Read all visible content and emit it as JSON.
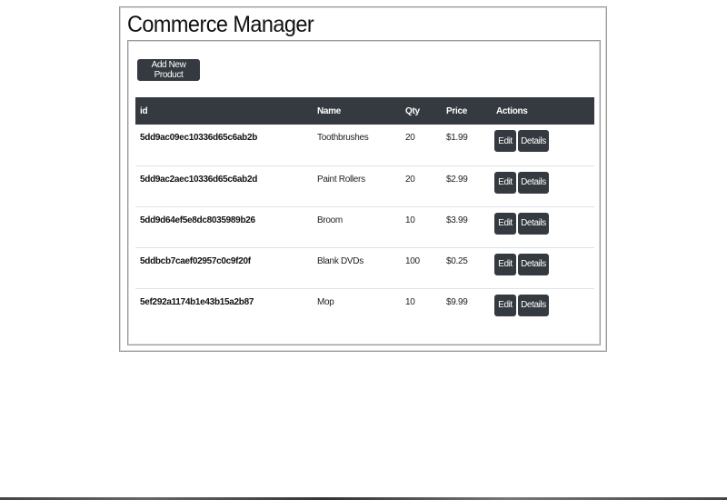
{
  "app": {
    "title": "Commerce Manager"
  },
  "toolbar": {
    "add_label": "Add New Product"
  },
  "table": {
    "columns": [
      "id",
      "Name",
      "Qty",
      "Price",
      "Actions"
    ],
    "rows": [
      {
        "id": "5dd9ac09ec10336d65c6ab2b",
        "name": "Toothbrushes",
        "qty": "20",
        "price": "$1.99"
      },
      {
        "id": "5dd9ac2aec10336d65c6ab2d",
        "name": "Paint Rollers",
        "qty": "20",
        "price": "$2.99"
      },
      {
        "id": "5dd9d64ef5e8dc8035989b26",
        "name": "Broom",
        "qty": "10",
        "price": "$3.99"
      },
      {
        "id": "5ddbcb7caef02957c0c9f20f",
        "name": "Blank DVDs",
        "qty": "100",
        "price": "$0.25"
      },
      {
        "id": "5ef292a1174b1e43b15a2b87",
        "name": "Mop",
        "qty": "10",
        "price": "$9.99"
      }
    ],
    "edit_label": "Edit",
    "details_label": "Details"
  },
  "colors": {
    "dark": "#343a40",
    "row_border": "#dee2e6",
    "frame_border": "#9a9a9a"
  }
}
